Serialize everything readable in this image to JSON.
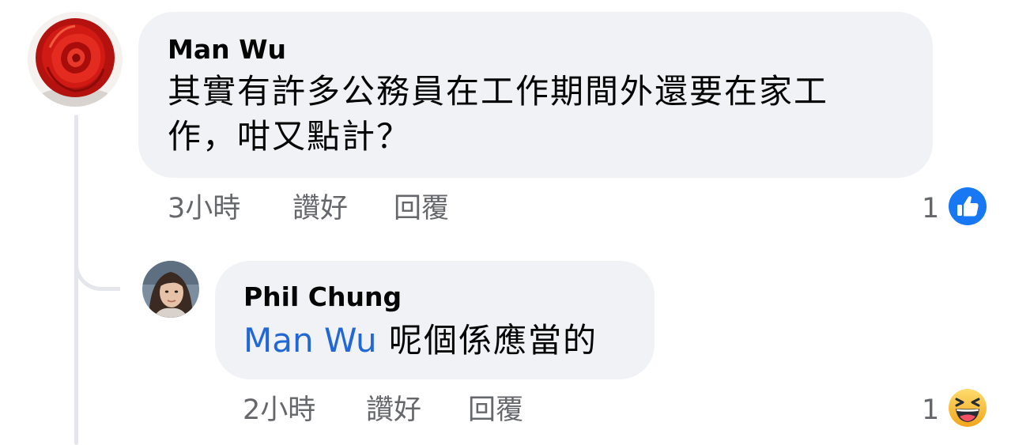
{
  "comments": [
    {
      "author": "Man Wu",
      "text_lines": [
        "其實有許多公務員在工作期間外還要在家工",
        "作，咁又點計？"
      ],
      "time": "3小時",
      "like_label": "讚好",
      "reply_label": "回覆",
      "reaction_count": "1",
      "reaction_icon": "like-icon",
      "avatar_icon": "red-rose-avatar"
    },
    {
      "author": "Phil Chung",
      "mention": "Man Wu",
      "text": "呢個係應當的",
      "time": "2小時",
      "like_label": "讚好",
      "reply_label": "回覆",
      "reaction_count": "1",
      "reaction_icon": "haha-icon",
      "avatar_icon": "person-photo-avatar"
    }
  ],
  "colors": {
    "bubble": "#f0f2f5",
    "mention": "#2167d6",
    "meta": "#65676b",
    "like_blue": "#1877f2",
    "haha_yellow": "#f7b928"
  }
}
